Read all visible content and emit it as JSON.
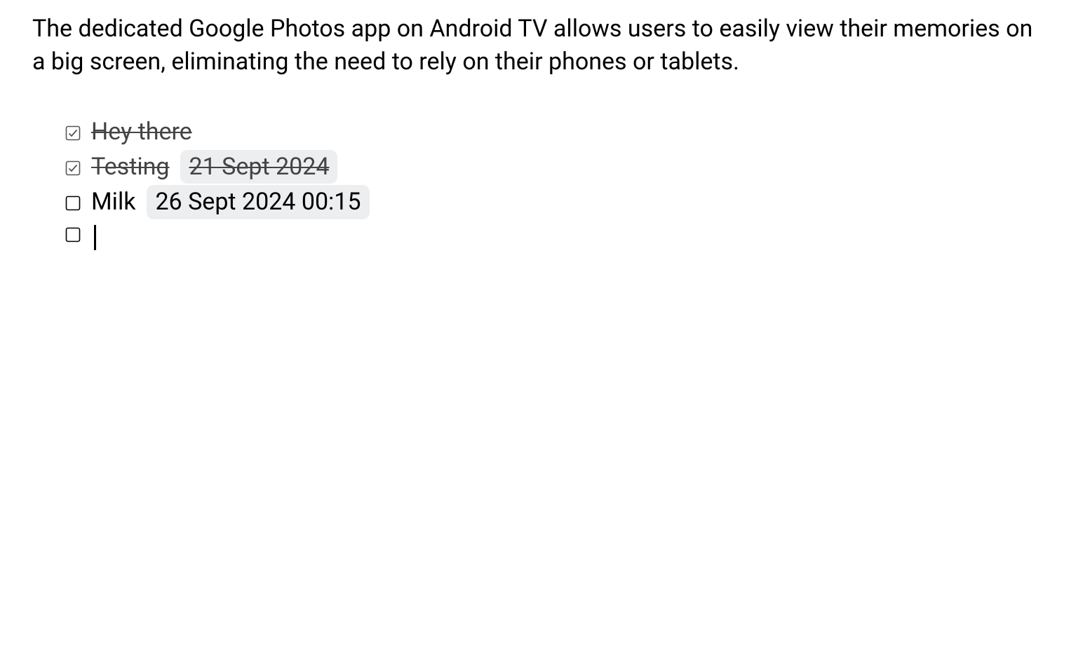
{
  "paragraph": "The dedicated Google Photos app on Android TV allows users to easily view their memories on a big screen, eliminating the need to rely on their phones or tablets.",
  "checklist": {
    "items": [
      {
        "checked": true,
        "label": "Hey there",
        "date": ""
      },
      {
        "checked": true,
        "label": "Testing",
        "date": "21 Sept 2024"
      },
      {
        "checked": false,
        "label": "Milk",
        "date": "26 Sept 2024 00:15"
      },
      {
        "checked": false,
        "label": "",
        "date": ""
      }
    ]
  }
}
